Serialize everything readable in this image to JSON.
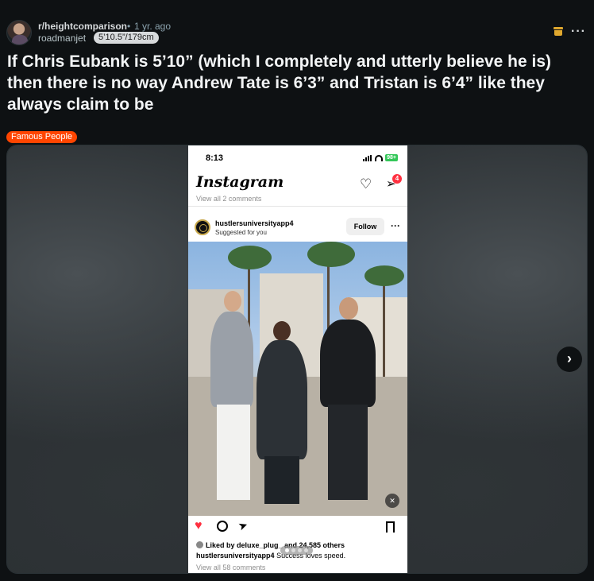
{
  "header": {
    "subreddit": "r/heightcomparison",
    "separator": "•",
    "time": "1 yr. ago",
    "username": "roadmanjet",
    "user_flair": "5’10.5”/179cm"
  },
  "actions": {
    "archive_icon": "archive-icon",
    "more_icon": "more-icon",
    "more_label": "···"
  },
  "post": {
    "title": "If Chris Eubank is 5’10” (which I completely and utterly believe he is) then there is no way Andrew Tate is 6’3” and Tristan is 6’4” like they always claim to be",
    "flair": "Famous People",
    "flair_color": "#ff4500"
  },
  "gallery": {
    "next_label": "›"
  },
  "screenshot": {
    "status_time": "8:13",
    "battery": "98+",
    "app_name": "Instagram",
    "dm_badge": "4",
    "view_prev_comments": "View all 2 comments",
    "account": "hustlersuniversityapp4",
    "account_sub": "Suggested for you",
    "follow_label": "Follow",
    "more_label": "···",
    "liked_by": "Liked by deluxe_plug_ and 24,585 others",
    "caption_user": "hustlersuniversityapp4",
    "caption_text": "Success loves speed.",
    "view_all_comments": "View all 58 comments"
  }
}
